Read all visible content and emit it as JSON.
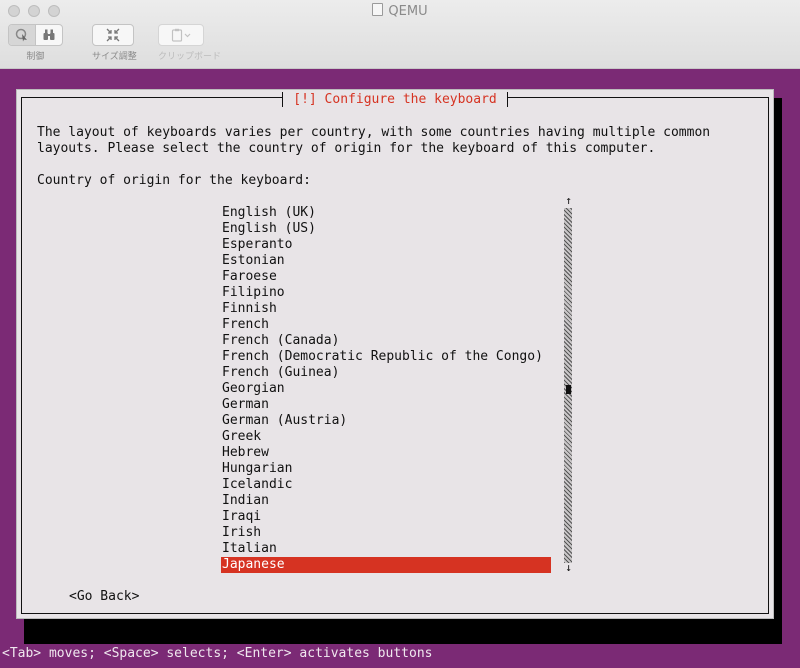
{
  "window": {
    "title": "QEMU",
    "toolbar": {
      "control_label": "制御",
      "resize_label": "サイズ調整",
      "clipboard_label": "クリップボード"
    }
  },
  "installer": {
    "dialog_title": "[!] Configure the keyboard",
    "description": "The layout of keyboards varies per country, with some countries having multiple common\nlayouts. Please select the country of origin for the keyboard of this computer.",
    "prompt": "Country of origin for the keyboard:",
    "countries": [
      "English (UK)",
      "English (US)",
      "Esperanto",
      "Estonian",
      "Faroese",
      "Filipino",
      "Finnish",
      "French",
      "French (Canada)",
      "French (Democratic Republic of the Congo)",
      "French (Guinea)",
      "Georgian",
      "German",
      "German (Austria)",
      "Greek",
      "Hebrew",
      "Hungarian",
      "Icelandic",
      "Indian",
      "Iraqi",
      "Irish",
      "Italian",
      "Japanese"
    ],
    "selected": "Japanese",
    "scroll_up": "↑",
    "scroll_down": "↓",
    "go_back": "<Go Back>",
    "help_line": "<Tab> moves; <Space> selects; <Enter> activates buttons"
  }
}
